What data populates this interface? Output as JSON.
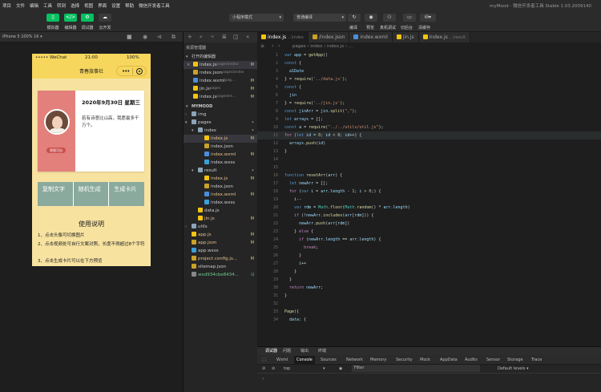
{
  "menubar": {
    "items": [
      "项目",
      "文件",
      "编辑",
      "工具",
      "转到",
      "选择",
      "视图",
      "界面",
      "设置",
      "帮助",
      "微信开发者工具"
    ],
    "app_title": "myMood - 微信开发者工具 Stable 1.03.2009140"
  },
  "toolbar": {
    "left_buttons": [
      {
        "label": "模拟器",
        "icon": "phone-icon"
      },
      {
        "label": "编辑器",
        "icon": "code-icon"
      },
      {
        "label": "调试器",
        "icon": "debug-icon"
      },
      {
        "label": "云开发",
        "icon": "cloud-icon"
      }
    ],
    "mode_select": "小程序模式",
    "compile_select": "普通编译",
    "right_buttons": [
      {
        "label": "编译"
      },
      {
        "label": "预览"
      },
      {
        "label": "真机调试"
      },
      {
        "label": "切后台"
      },
      {
        "label": "清缓存"
      }
    ]
  },
  "simulator": {
    "device": "iPhone 5 100% 16 ▾",
    "status": {
      "carrier": "••••• WeChat",
      "time": "21:00",
      "battery": "100%"
    },
    "nav_title": "青春旅事社",
    "card": {
      "date": "2020年9月30日 星期三",
      "quote": "若有诗意比山高，我愿最多千万个。",
      "badge": "原图可自"
    },
    "buttons": [
      "复制文字",
      "随机生成",
      "生成卡片"
    ],
    "usage": {
      "title": "使用说明",
      "lines": [
        "1、点击头像可切换图片",
        "2、点击视频处可自行文案对照，长度不得超过8个字符",
        "3、点击生成卡片可以在下方预览"
      ]
    }
  },
  "explorer": {
    "header": "资源管理器",
    "open_editors": "打开的编辑器",
    "project": "MYMOOD",
    "open_files": [
      {
        "name": "index.js",
        "extra": "pages\\index",
        "mark": "M",
        "icon": "js"
      },
      {
        "name": "index.json",
        "extra": "pages\\index",
        "mark": "",
        "icon": "json"
      },
      {
        "name": "index.wxml",
        "extra": "pag...",
        "mark": "M",
        "icon": "wxml"
      },
      {
        "name": "jin.js",
        "extra": "pages",
        "mark": "M",
        "icon": "js"
      },
      {
        "name": "index.js",
        "extra": "pages\\re...",
        "mark": "M",
        "icon": "js"
      }
    ],
    "tree": [
      {
        "name": "img",
        "indent": 1,
        "type": "folder",
        "mark": ""
      },
      {
        "name": "pages",
        "indent": 1,
        "type": "folder-open",
        "mark": "•"
      },
      {
        "name": "index",
        "indent": 2,
        "type": "folder-open",
        "mark": "•"
      },
      {
        "name": "index.js",
        "indent": 3,
        "type": "js",
        "mark": "M",
        "sel": true
      },
      {
        "name": "index.json",
        "indent": 3,
        "type": "json",
        "mark": ""
      },
      {
        "name": "index.wxml",
        "indent": 3,
        "type": "wxml",
        "mark": "M"
      },
      {
        "name": "index.wxss",
        "indent": 3,
        "type": "wxss",
        "mark": ""
      },
      {
        "name": "result",
        "indent": 2,
        "type": "folder-open",
        "mark": "•"
      },
      {
        "name": "index.js",
        "indent": 3,
        "type": "js",
        "mark": "M"
      },
      {
        "name": "index.json",
        "indent": 3,
        "type": "json",
        "mark": ""
      },
      {
        "name": "index.wxml",
        "indent": 3,
        "type": "wxml",
        "mark": "M"
      },
      {
        "name": "index.wxss",
        "indent": 3,
        "type": "wxss",
        "mark": ""
      },
      {
        "name": "data.js",
        "indent": 2,
        "type": "js",
        "mark": ""
      },
      {
        "name": "jin.js",
        "indent": 2,
        "type": "js",
        "mark": "M"
      },
      {
        "name": "utils",
        "indent": 1,
        "type": "folder",
        "mark": ""
      },
      {
        "name": "app.js",
        "indent": 1,
        "type": "js",
        "mark": "M"
      },
      {
        "name": "app.json",
        "indent": 1,
        "type": "json",
        "mark": "M"
      },
      {
        "name": "app.wxss",
        "indent": 1,
        "type": "wxss",
        "mark": ""
      },
      {
        "name": "project.config.js...",
        "indent": 1,
        "type": "json",
        "mark": "M"
      },
      {
        "name": "sitemap.json",
        "indent": 1,
        "type": "json",
        "mark": ""
      },
      {
        "name": "wxd934cbe8434...",
        "indent": 1,
        "type": "txt",
        "mark": "U"
      }
    ]
  },
  "editor": {
    "tabs": [
      {
        "label": "index.js",
        "extra": "...\\index",
        "active": true
      },
      {
        "label": "/index.json",
        "extra": "",
        "active": false
      },
      {
        "label": "index.wxml",
        "extra": "",
        "active": false
      },
      {
        "label": "jin.js",
        "extra": "",
        "active": false
      },
      {
        "label": "index.js",
        "extra": "...\\result",
        "active": false
      }
    ],
    "breadcrumb": "pages › index › index.js › ...",
    "lines": [
      [
        "1",
        "<span class='kw'>var</span> <span class='vr'>app</span> = <span class='fn'>getApp</span>()"
      ],
      [
        "2",
        "<span class='kw'>const</span> {"
      ],
      [
        "3",
        "  <span class='vr'>a1Date</span>"
      ],
      [
        "4",
        "} = <span class='fn'>require</span>(<span class='st'>'../data.js'</span>);"
      ],
      [
        "5",
        "<span class='kw'>const</span> {"
      ],
      [
        "6",
        "  <span class='vr'>jin</span>"
      ],
      [
        "7",
        "} = <span class='fn'>require</span>(<span class='st'>'../jin.js'</span>);"
      ],
      [
        "8",
        "<span class='kw'>const</span> <span class='vr'>jinArr</span> = <span class='vr'>jin</span>.<span class='fn'>split</span>(<span class='st'>\",\"</span>);"
      ],
      [
        "9",
        "<span class='kw'>let</span> <span class='vr'>arrays</span> = [];"
      ],
      [
        "10",
        "<span class='kw'>const</span> <span class='vr'>a</span> = <span class='fn'>require</span>(<span class='st'>\"../../utils/util.js\"</span>);"
      ],
      [
        "11",
        "<span class='cf'>for</span> (<span class='kw'>let</span> <span class='vr'>id</span> = <span class='nm2'>0</span>; <span class='vr'>id</span> &lt; <span class='nm2'>8</span>; <span class='vr'>id</span>++) {"
      ],
      [
        "12",
        "  <span class='vr'>arrays</span>.<span class='fn'>push</span>(<span class='vr'>id</span>)"
      ],
      [
        "13",
        "}"
      ],
      [
        "14",
        ""
      ],
      [
        "15",
        ""
      ],
      [
        "16",
        "<span class='kw'>function</span> <span class='fn'>resetArr</span>(<span class='vr'>arr</span>) {"
      ],
      [
        "17",
        "  <span class='kw'>let</span> <span class='vr'>newArr</span> = [];"
      ],
      [
        "18",
        "  <span class='cf'>for</span> (<span class='kw'>var</span> <span class='vr'>i</span> = <span class='vr'>arr</span>.<span class='vr'>length</span> - <span class='nm2'>1</span>; <span class='vr'>i</span> &gt; <span class='nm2'>0</span>;) {"
      ],
      [
        "19",
        "    <span class='vr'>i</span>--"
      ],
      [
        "20",
        "    <span class='kw'>var</span> <span class='vr'>rdm</span> = <span class='ty'>Math</span>.<span class='fn'>floor</span>(<span class='ty'>Math</span>.<span class='fn'>random</span>() * <span class='vr'>arr</span>.<span class='vr'>length</span>)"
      ],
      [
        "21",
        "    <span class='cf'>if</span> (!<span class='vr'>newArr</span>.<span class='fn'>includes</span>(<span class='vr'>arr</span>[<span class='vr'>rdm</span>])) {"
      ],
      [
        "22",
        "      <span class='vr'>newArr</span>.<span class='fn'>push</span>(<span class='vr'>arr</span>[<span class='vr'>rdm</span>])"
      ],
      [
        "23",
        "    } <span class='cf'>else</span> {"
      ],
      [
        "24",
        "      <span class='cf'>if</span> (<span class='vr'>newArr</span>.<span class='vr'>length</span> == <span class='vr'>arr</span>.<span class='vr'>length</span>) {"
      ],
      [
        "25",
        "        <span class='cf'>break</span>;"
      ],
      [
        "26",
        "      }"
      ],
      [
        "27",
        "      <span class='vr'>i</span>++"
      ],
      [
        "28",
        "    }"
      ],
      [
        "29",
        "  }"
      ],
      [
        "30",
        "  <span class='cf'>return</span> <span class='vr'>newArr</span>;"
      ],
      [
        "31",
        "}"
      ],
      [
        "32",
        ""
      ],
      [
        "33",
        "<span class='fn'>Page</span>({"
      ],
      [
        "34",
        "  <span class='vr'>data</span>: {"
      ]
    ]
  },
  "devtools": {
    "top_tabs": [
      "调试器",
      "问题",
      "输出",
      "终端"
    ],
    "tabs": [
      "Wxml",
      "Console",
      "Sources",
      "Network",
      "Memory",
      "Security",
      "Mock",
      "AppData",
      "Audits",
      "Sensor",
      "Storage",
      "Trace"
    ],
    "context": "top",
    "filter_placeholder": "Filter",
    "levels": "Default levels ▾",
    "prompt": "›"
  },
  "colors": {
    "accent": "#07c160",
    "nav": "#f6d65d",
    "page_bg": "#f7e2a0",
    "card_left": "#e3807c",
    "buttons": "#8aaa9d"
  }
}
